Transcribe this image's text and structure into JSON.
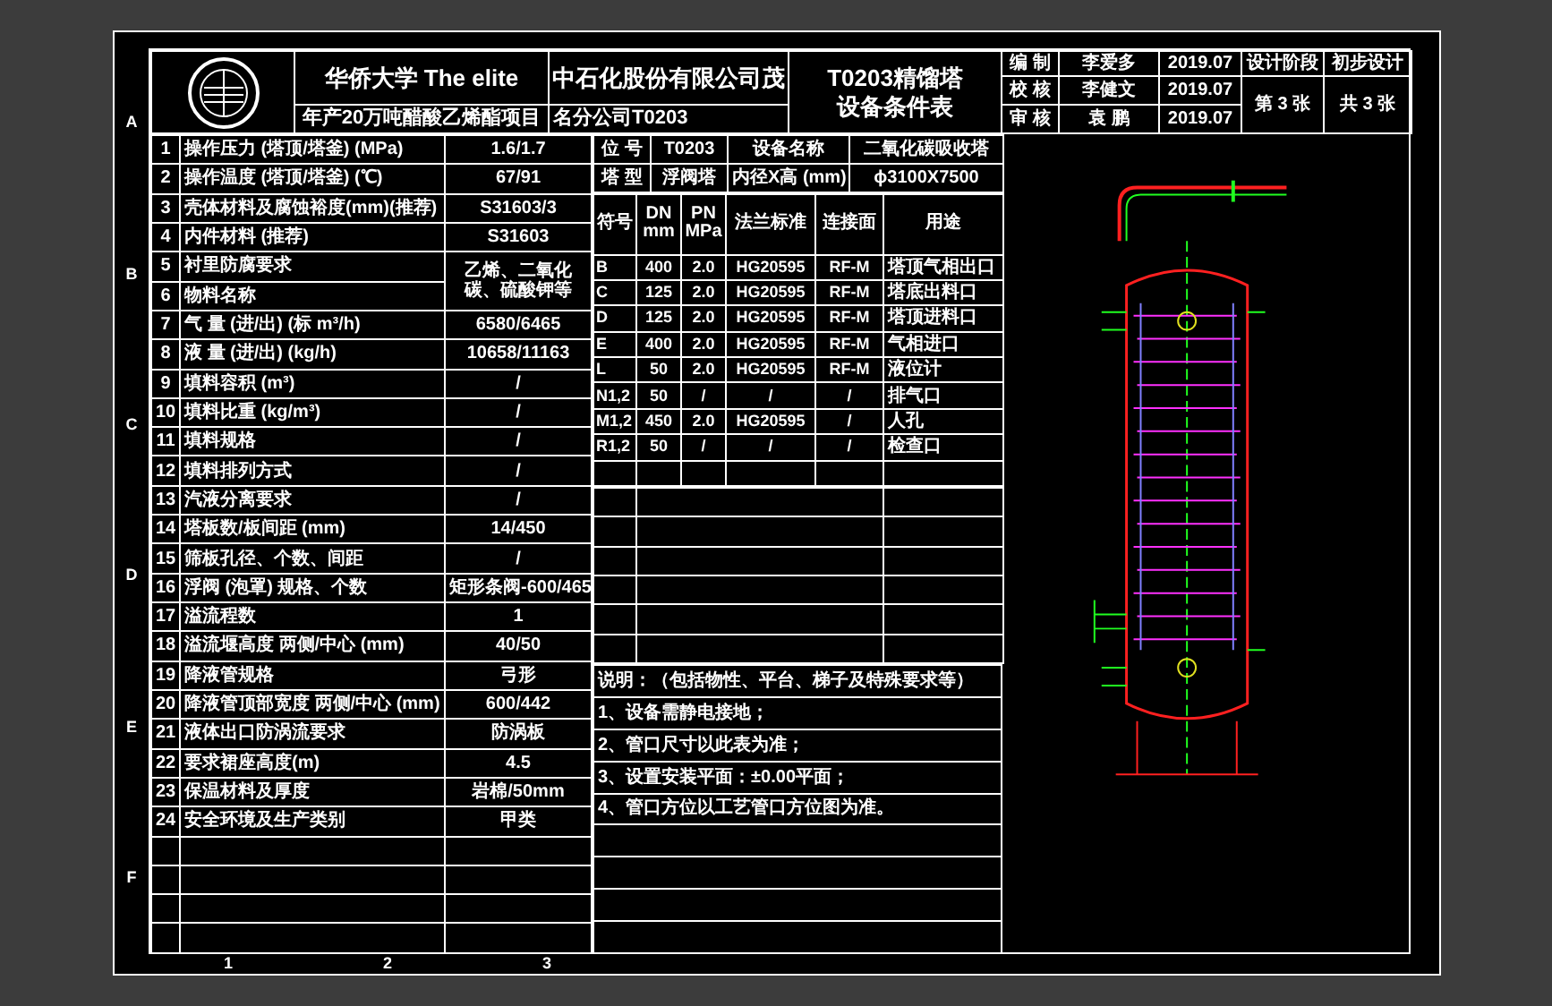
{
  "title_block": {
    "school": "华侨大学 The elite",
    "project": "年产20万吨醋酸乙烯酯项目",
    "company": "中石化股份有限公司茂",
    "branch": "名分公司T0203",
    "drawing_title": "T0203精馏塔",
    "drawing_subtitle": "设备条件表",
    "signatures": [
      {
        "role": "编 制",
        "name": "李爱多",
        "date": "2019.07"
      },
      {
        "role": "校 核",
        "name": "李健文",
        "date": "2019.07"
      },
      {
        "role": "审 核",
        "name": "袁 鹏",
        "date": "2019.07"
      }
    ],
    "stage_label": "设计阶段",
    "stage": "初步设计",
    "sheet": "第 3 张",
    "total": "共 3 张"
  },
  "conditions": [
    {
      "no": "1",
      "label": "操作压力 (塔顶/塔釜) (MPa)",
      "value": "1.6/1.7"
    },
    {
      "no": "2",
      "label": "操作温度 (塔顶/塔釜) (℃)",
      "value": "67/91"
    },
    {
      "no": "3",
      "label": "壳体材料及腐蚀裕度(mm)(推荐)",
      "value": "S31603/3"
    },
    {
      "no": "4",
      "label": "内件材料 (推荐)",
      "value": "S31603"
    },
    {
      "no": "5",
      "label": "衬里防腐要求"
    },
    {
      "no": "6",
      "label": "物料名称",
      "value": "乙烯、二氧化碳、硫酸钾等"
    },
    {
      "no": "7",
      "label": "气 量 (进/出) (标 m³/h)",
      "value": "6580/6465"
    },
    {
      "no": "8",
      "label": "液 量 (进/出) (kg/h)",
      "value": "10658/11163"
    },
    {
      "no": "9",
      "label": "填料容积 (m³)",
      "value": "/"
    },
    {
      "no": "10",
      "label": "填料比重 (kg/m³)",
      "value": "/"
    },
    {
      "no": "11",
      "label": "填料规格",
      "value": "/"
    },
    {
      "no": "12",
      "label": "填料排列方式",
      "value": "/"
    },
    {
      "no": "13",
      "label": "汽液分离要求",
      "value": "/"
    },
    {
      "no": "14",
      "label": "塔板数/板间距 (mm)",
      "value": "14/450"
    },
    {
      "no": "15",
      "label": "筛板孔径、个数、间距",
      "value": "/"
    },
    {
      "no": "16",
      "label": "浮阀 (泡罩) 规格、个数",
      "value": "矩形条阀-600/465"
    },
    {
      "no": "17",
      "label": "溢流程数",
      "value": "1"
    },
    {
      "no": "18",
      "label": "溢流堰高度 两侧/中心 (mm)",
      "value": "40/50"
    },
    {
      "no": "19",
      "label": "降液管规格",
      "value": "弓形"
    },
    {
      "no": "20",
      "label": "降液管顶部宽度 两侧/中心 (mm)",
      "value": "600/442"
    },
    {
      "no": "21",
      "label": "液体出口防涡流要求",
      "value": "防涡板"
    },
    {
      "no": "22",
      "label": "要求裙座高度(m)",
      "value": "4.5"
    },
    {
      "no": "23",
      "label": "保温材料及厚度",
      "value": "岩棉/50mm"
    },
    {
      "no": "24",
      "label": "安全环境及生产类别",
      "value": "甲类"
    }
  ],
  "equipment": {
    "tag_label": "位 号",
    "tag": "T0203",
    "name_label": "设备名称",
    "name": "二氧化碳吸收塔",
    "type_label": "塔 型",
    "type": "浮阀塔",
    "size_label": "内径X高 (mm)",
    "size": "ϕ3100X7500"
  },
  "nozzle_columns": [
    "符号",
    "DN mm",
    "PN MPa",
    "法兰标准",
    "连接面",
    "用途"
  ],
  "nozzles": [
    {
      "mark": "B",
      "dn": "400",
      "pn": "2.0",
      "flange": "HG20595",
      "face": "RF-M",
      "use": "塔顶气相出口"
    },
    {
      "mark": "C",
      "dn": "125",
      "pn": "2.0",
      "flange": "HG20595",
      "face": "RF-M",
      "use": "塔底出料口"
    },
    {
      "mark": "D",
      "dn": "125",
      "pn": "2.0",
      "flange": "HG20595",
      "face": "RF-M",
      "use": "塔顶进料口"
    },
    {
      "mark": "E",
      "dn": "400",
      "pn": "2.0",
      "flange": "HG20595",
      "face": "RF-M",
      "use": "气相进口"
    },
    {
      "mark": "L",
      "dn": "50",
      "pn": "2.0",
      "flange": "HG20595",
      "face": "RF-M",
      "use": "液位计"
    },
    {
      "mark": "N1,2",
      "dn": "50",
      "pn": "/",
      "flange": "/",
      "face": "/",
      "use": "排气口"
    },
    {
      "mark": "M1,2",
      "dn": "450",
      "pn": "2.0",
      "flange": "HG20595",
      "face": "/",
      "use": "人孔"
    },
    {
      "mark": "R1,2",
      "dn": "50",
      "pn": "/",
      "flange": "/",
      "face": "/",
      "use": "检查口"
    }
  ],
  "notes_title": "说明：（包括物性、平台、梯子及特殊要求等）",
  "notes": [
    "1、设备需静电接地；",
    "2、管口尺寸以此表为准；",
    "3、设置安装平面：±0.00平面；",
    "4、管口方位以工艺管口方位图为准。"
  ],
  "zone_letters": [
    "A",
    "B",
    "C",
    "D",
    "E",
    "F"
  ],
  "zone_numbers": [
    "1",
    "2",
    "3"
  ]
}
